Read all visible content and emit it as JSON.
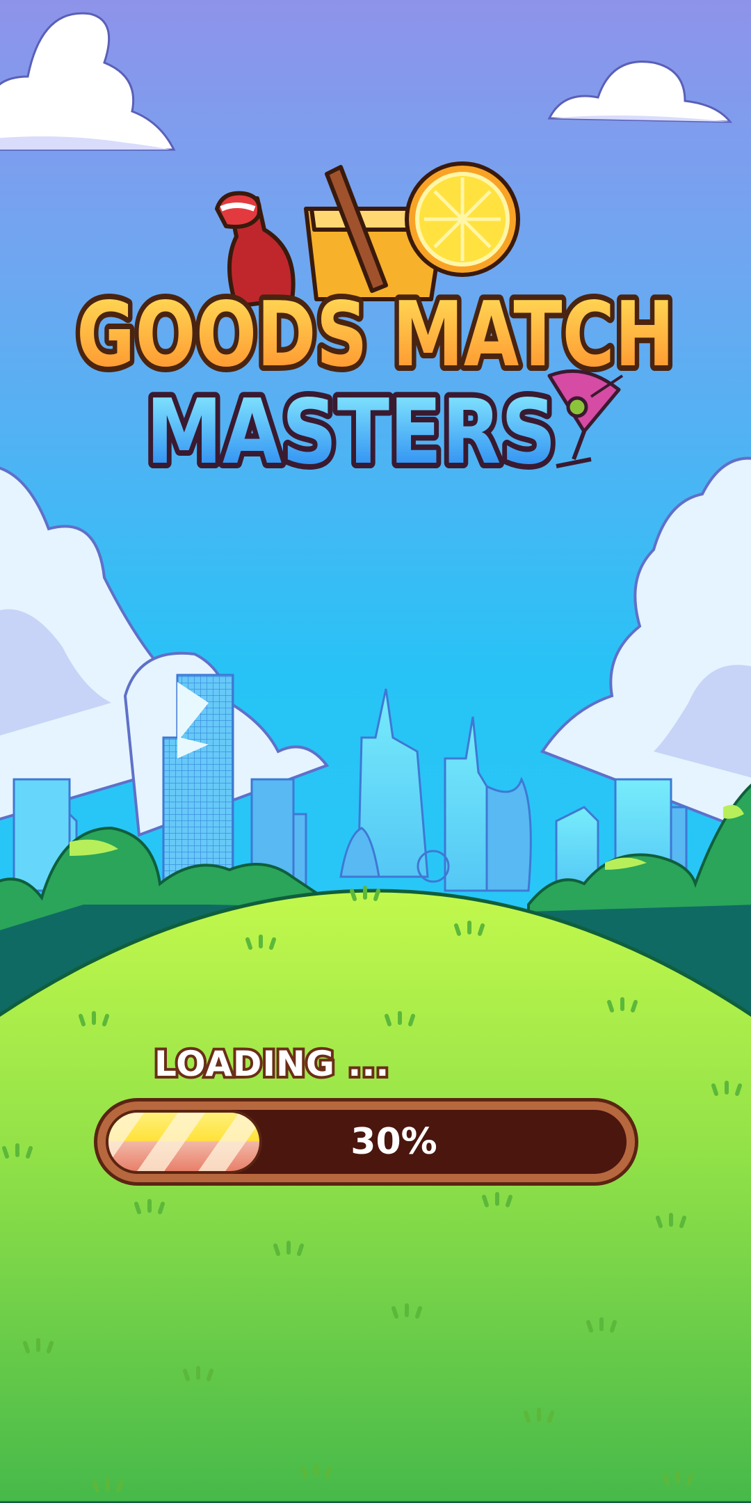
{
  "game": {
    "title_line1": "GOODS MATCH",
    "title_line2": "MASTERS"
  },
  "loading": {
    "label": "LOADING ...",
    "progress": 0.3,
    "progress_text": "30%"
  },
  "colors": {
    "sky_top": "#8e93ea",
    "sky_bottom": "#27c3f6",
    "hill_top": "#bff54a",
    "hill_bottom": "#4cbd4a",
    "title_line1_fill": "#ffb12e",
    "title_line2_fill": "#3ab4f5",
    "title_outline": "#4a2410",
    "bar_frame": "#b8683e",
    "bar_track": "#4a160e"
  },
  "icons": [
    "cola-bottle-icon",
    "juice-glass-icon",
    "lemon-slice-icon",
    "cocktail-glass-icon"
  ]
}
